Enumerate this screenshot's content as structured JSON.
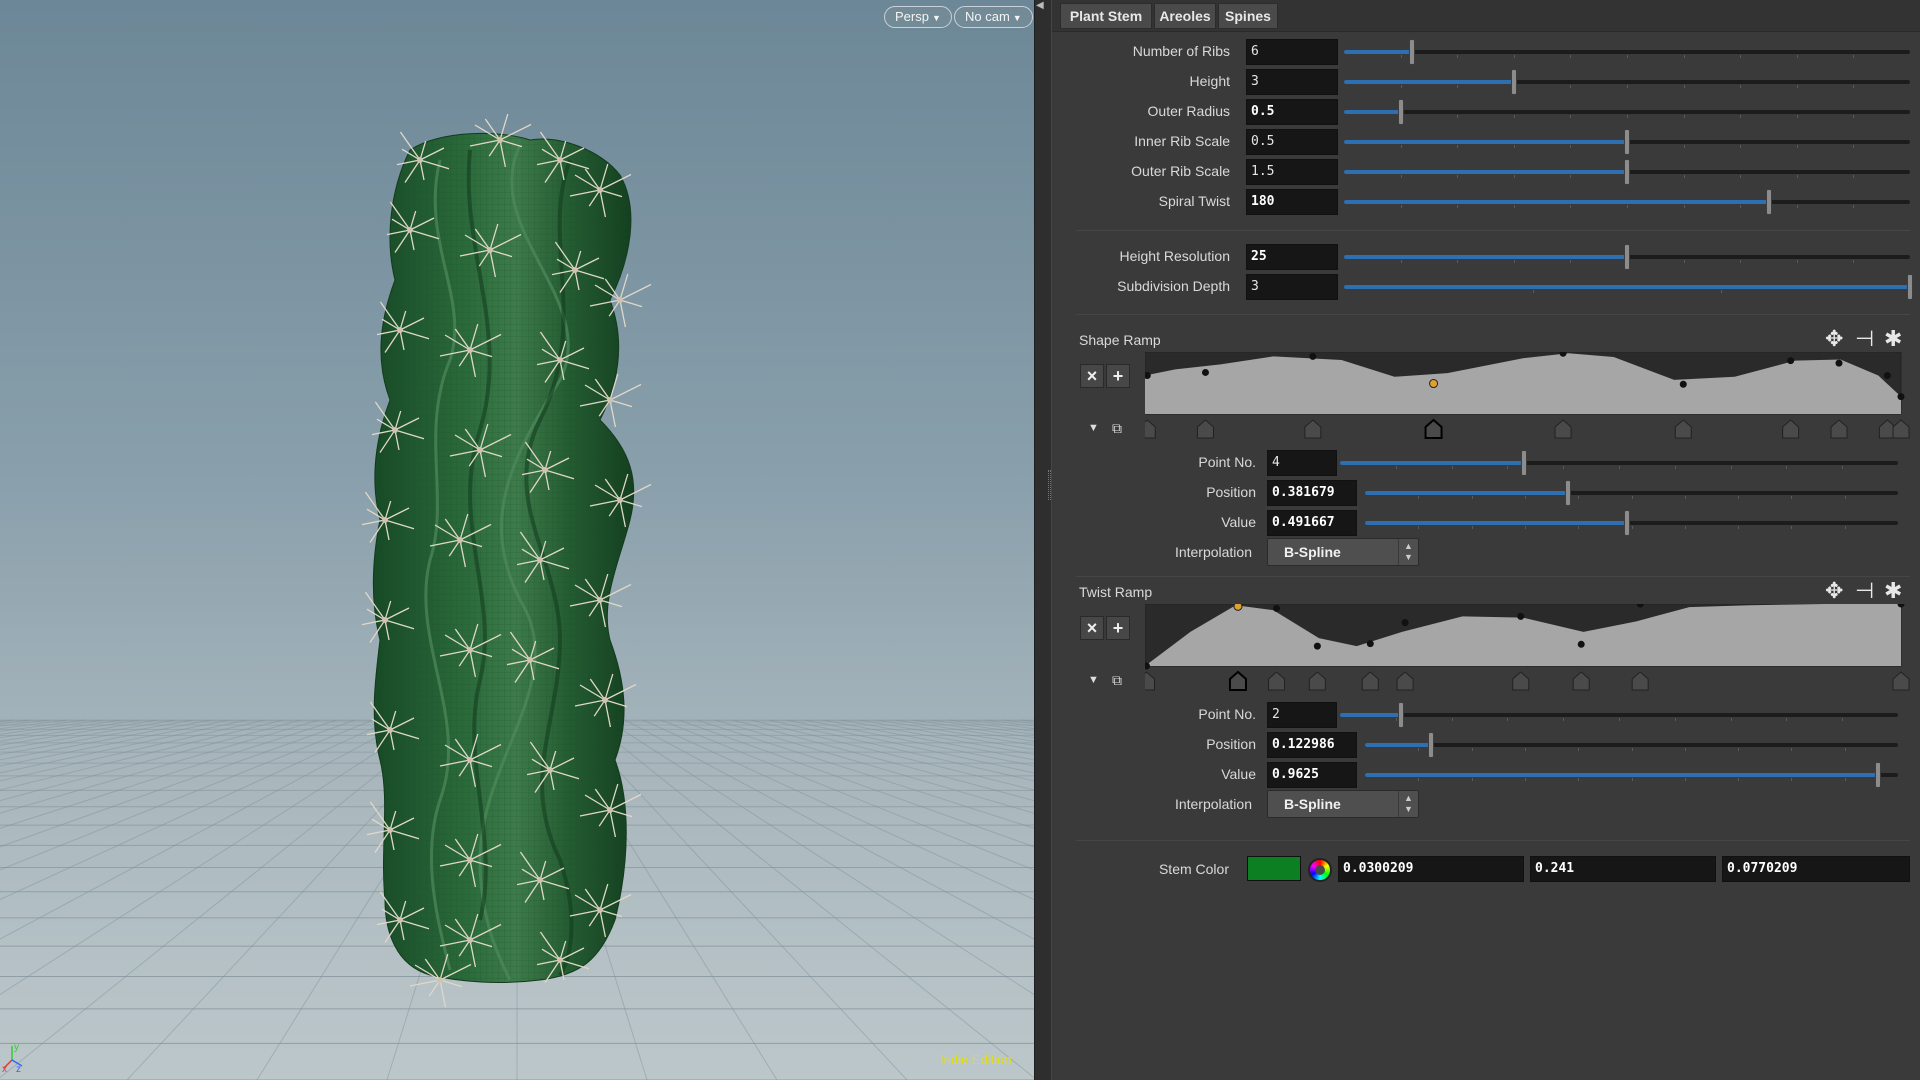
{
  "viewport": {
    "camera_menu": "Persp",
    "cam_menu": "No cam",
    "edition_label": "Indie Edition",
    "axis_labels": {
      "x": "x",
      "y": "y",
      "z": "z"
    }
  },
  "tabs": [
    {
      "label": "Plant Stem",
      "active": true
    },
    {
      "label": "Areoles",
      "active": false
    },
    {
      "label": "Spines",
      "active": false
    }
  ],
  "params": {
    "number_of_ribs": {
      "label": "Number of Ribs",
      "value": "6",
      "fraction": 0.12
    },
    "height": {
      "label": "Height",
      "value": "3",
      "fraction": 0.3
    },
    "outer_radius": {
      "label": "Outer Radius",
      "value": "0.5",
      "fraction": 0.1
    },
    "inner_rib_scale": {
      "label": "Inner Rib Scale",
      "value": "0.5",
      "fraction": 0.5
    },
    "outer_rib_scale": {
      "label": "Outer Rib Scale",
      "value": "1.5",
      "fraction": 0.5
    },
    "spiral_twist": {
      "label": "Spiral Twist",
      "value": "180",
      "fraction": 0.75
    },
    "height_resolution": {
      "label": "Height Resolution",
      "value": "25",
      "fraction": 0.5
    },
    "subdivision_depth": {
      "label": "Subdivision Depth",
      "value": "3",
      "fraction": 1.0
    }
  },
  "shape_ramp": {
    "label": "Shape Ramp",
    "point_no": {
      "label": "Point No.",
      "value": "4",
      "fraction": 0.33
    },
    "position": {
      "label": "Position",
      "value": "0.381679",
      "fraction": 0.381679
    },
    "value": {
      "label": "Value",
      "value": "0.491667",
      "fraction": 0.491667
    },
    "interpolation": {
      "label": "Interpolation",
      "value": "B-Spline"
    }
  },
  "twist_ramp": {
    "label": "Twist Ramp",
    "point_no": {
      "label": "Point No.",
      "value": "2",
      "fraction": 0.11
    },
    "position": {
      "label": "Position",
      "value": "0.122986",
      "fraction": 0.122986
    },
    "value": {
      "label": "Value",
      "value": "0.9625",
      "fraction": 0.9625
    },
    "interpolation": {
      "label": "Interpolation",
      "value": "B-Spline"
    }
  },
  "stem_color": {
    "label": "Stem Color",
    "swatch": "#0c7f22",
    "r": "0.0300209",
    "g": "0.241",
    "b": "0.0770209"
  },
  "colors": {
    "accent_fill": "#2d6fb0",
    "selected_point": "#e0a030",
    "cactus": "#1f5a30"
  }
}
